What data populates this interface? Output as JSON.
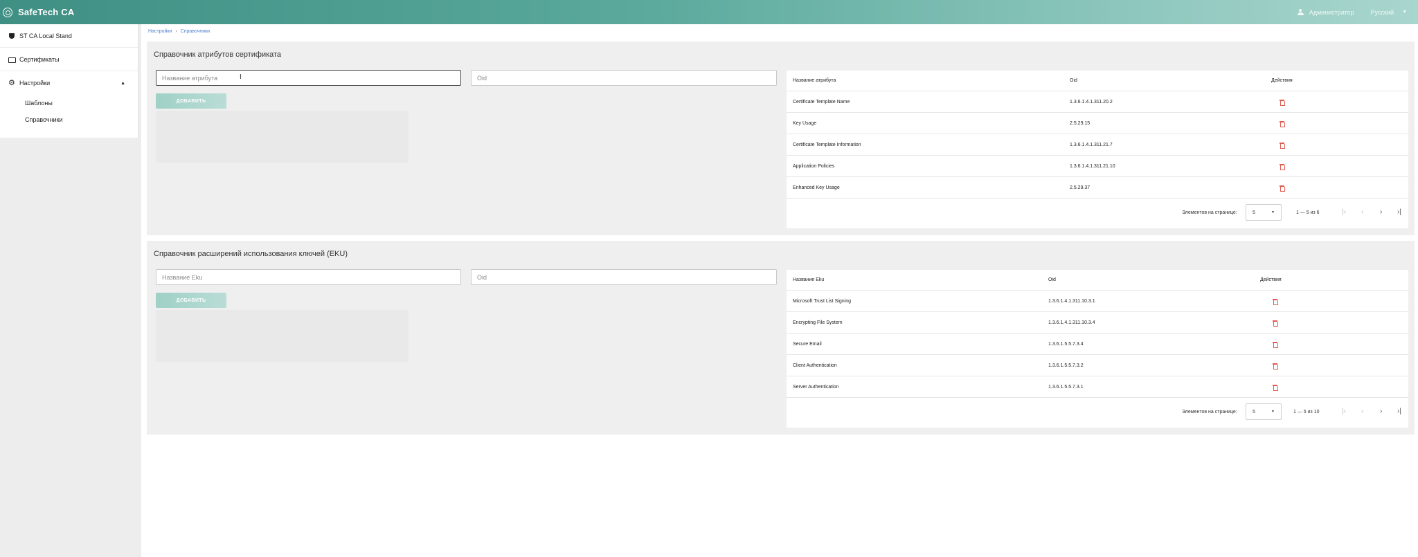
{
  "header": {
    "app_title": "SafeTech CA",
    "user": "Администратор",
    "language": "Русский"
  },
  "sidebar": {
    "items": [
      {
        "label": "ST CA Local Stand",
        "icon": "shield-icon"
      },
      {
        "label": "Сертификаты",
        "icon": "certificate-icon"
      },
      {
        "label": "Настройки",
        "icon": "gear-icon"
      }
    ],
    "sub_items": [
      {
        "label": "Шаблоны"
      },
      {
        "label": "Справочники"
      }
    ]
  },
  "breadcrumb": {
    "parent": "Настройки",
    "separator": "›",
    "current": "Справочники"
  },
  "attributes_section": {
    "title": "Справочник атрибутов сертификата",
    "name_placeholder": "Название атрибута",
    "oid_placeholder": "Oid",
    "add_label": "ДОБАВИТЬ",
    "columns": [
      "Название атрибута",
      "Oid",
      "Действия"
    ],
    "rows": [
      {
        "name": "Certificate Template Name",
        "oid": "1.3.6.1.4.1.311.20.2"
      },
      {
        "name": "Key Usage",
        "oid": "2.5.29.15"
      },
      {
        "name": "Certificate Template Information",
        "oid": "1.3.6.1.4.1.311.21.7"
      },
      {
        "name": "Application Policies",
        "oid": "1.3.6.1.4.1.311.21.10"
      },
      {
        "name": "Enhanced Key Usage",
        "oid": "2.5.29.37"
      }
    ],
    "pager": {
      "label": "Элементов на странице:",
      "page_size": "5",
      "range": "1 — 5 из 6"
    }
  },
  "eku_section": {
    "title": "Справочник расширений использования ключей (EKU)",
    "name_placeholder": "Название Eku",
    "oid_placeholder": "Oid",
    "add_label": "ДОБАВИТЬ",
    "columns": [
      "Название Eku",
      "Oid",
      "Действия"
    ],
    "rows": [
      {
        "name": "Microsoft Trust List Signing",
        "oid": "1.3.6.1.4.1.311.10.3.1"
      },
      {
        "name": "Encrypting File System",
        "oid": "1.3.6.1.4.1.311.10.3.4"
      },
      {
        "name": "Secure Email",
        "oid": "1.3.6.1.5.5.7.3.4"
      },
      {
        "name": "Client Authentication",
        "oid": "1.3.6.1.5.5.7.3.2"
      },
      {
        "name": "Server Authentication",
        "oid": "1.3.6.1.5.5.7.3.1"
      }
    ],
    "pager": {
      "label": "Элементов на странице:",
      "page_size": "5",
      "range": "1 — 5 из 10"
    }
  },
  "pager_icons": [
    "first-page-icon",
    "prev-page-icon",
    "next-page-icon",
    "last-page-icon"
  ],
  "colors": {
    "accent": "#5aa99c",
    "delete": "#e05a4f",
    "link": "#4f7fd0"
  }
}
